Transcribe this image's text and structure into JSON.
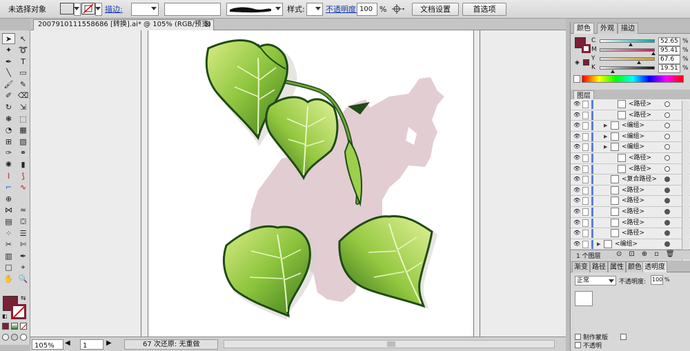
{
  "control_bar": {
    "selection_status": "未选择对象",
    "stroke_label": "描边:",
    "style_label": "样式:",
    "opacity_label": "不透明度:",
    "opacity_value": "100",
    "opacity_unit": "%",
    "doc_setup_button": "文档设置",
    "preferences_button": "首选项",
    "fill_color": "#7a2135"
  },
  "document": {
    "tab_title": "2007910111558686 [转换].ai* @ 105% (RGB/预览)",
    "tab_close": "⊠"
  },
  "status_bar": {
    "zoom": "105%",
    "artboard_number": "1",
    "status_text": "67 次还原: 无重做",
    "arrow_right": "▶",
    "arrow_left": "◀"
  },
  "color_panel": {
    "tabs": [
      "颜色",
      "外观",
      "描边"
    ],
    "channels": [
      {
        "key": "C",
        "value": "52.65",
        "unit": "%",
        "level": 0.5265
      },
      {
        "key": "M",
        "value": "95.41",
        "unit": "%",
        "level": 0.9541
      },
      {
        "key": "Y",
        "value": "67.6",
        "unit": "%",
        "level": 0.676
      },
      {
        "key": "K",
        "value": "19.51",
        "unit": "%",
        "level": 0.1951
      }
    ]
  },
  "layers_panel": {
    "title": "图层",
    "rows": [
      {
        "name": "<路径>",
        "indent": 2,
        "expand": false,
        "target_filled": false
      },
      {
        "name": "<路径>",
        "indent": 2,
        "expand": false,
        "target_filled": false
      },
      {
        "name": "<编组>",
        "indent": 1,
        "expand": true,
        "target_filled": false
      },
      {
        "name": "<编组>",
        "indent": 1,
        "expand": true,
        "target_filled": false
      },
      {
        "name": "<编组>",
        "indent": 1,
        "expand": true,
        "target_filled": false
      },
      {
        "name": "<路径>",
        "indent": 2,
        "expand": false,
        "target_filled": false
      },
      {
        "name": "<路径>",
        "indent": 2,
        "expand": false,
        "target_filled": false
      },
      {
        "name": "<复合路径>",
        "indent": 1,
        "expand": false,
        "target_filled": true
      },
      {
        "name": "<路径>",
        "indent": 1,
        "expand": false,
        "target_filled": true
      },
      {
        "name": "<路径>",
        "indent": 1,
        "expand": false,
        "target_filled": true
      },
      {
        "name": "<路径>",
        "indent": 1,
        "expand": false,
        "target_filled": true
      },
      {
        "name": "<路径>",
        "indent": 1,
        "expand": false,
        "target_filled": true
      },
      {
        "name": "<路径>",
        "indent": 1,
        "expand": false,
        "target_filled": true
      },
      {
        "name": "<编组>",
        "indent": 0,
        "expand": true,
        "target_filled": true
      }
    ],
    "layer_count": "1 个图层"
  },
  "transparency_panel": {
    "tabs": [
      "渐变",
      "路径",
      "属性",
      "颜色",
      "透明度"
    ],
    "blend_mode": "正常",
    "opacity_label": "不透明度:",
    "opacity_value": "100",
    "opacity_unit": "%",
    "option_1": "制作蒙版",
    "option_2": "不透明"
  }
}
